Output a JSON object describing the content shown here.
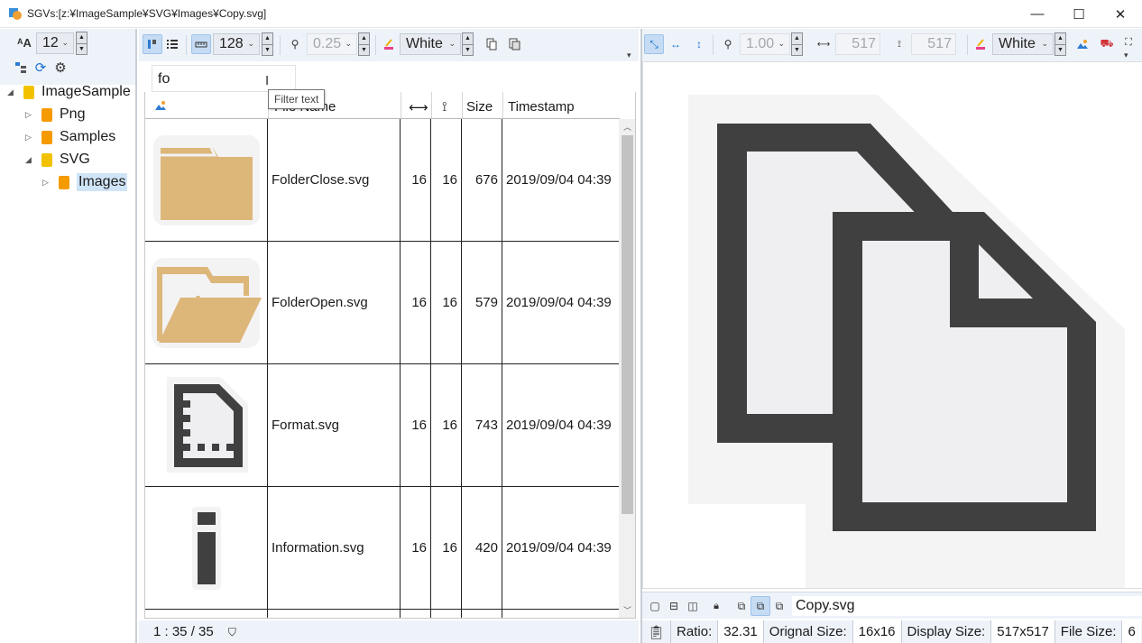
{
  "window": {
    "title": "SGVs:[z:¥ImageSample¥SVG¥Images¥Copy.svg]",
    "controls": {
      "minimize": "—",
      "maximize": "☐",
      "close": "✕"
    }
  },
  "left": {
    "font_size": "12",
    "tree": [
      {
        "label": "ImageSample",
        "expanded": true,
        "level": 0
      },
      {
        "label": "Png",
        "expanded": false,
        "level": 1
      },
      {
        "label": "Samples",
        "expanded": false,
        "level": 1
      },
      {
        "label": "SVG",
        "expanded": true,
        "level": 1
      },
      {
        "label": "Images",
        "expanded": false,
        "level": 2,
        "selected": true
      }
    ]
  },
  "middle": {
    "thumb_size": "128",
    "zoom": "0.25",
    "background": "White",
    "filter_value": "fo",
    "filter_tooltip": "Filter text",
    "columns": {
      "icon": "",
      "name": "File Name",
      "width": "",
      "height": "",
      "size": "Size",
      "timestamp": "Timestamp"
    },
    "rows": [
      {
        "name": "FolderClose.svg",
        "w": "16",
        "h": "16",
        "size": "676",
        "timestamp": "2019/09/04 04:39",
        "icon": "folder-close"
      },
      {
        "name": "FolderOpen.svg",
        "w": "16",
        "h": "16",
        "size": "579",
        "timestamp": "2019/09/04 04:39",
        "icon": "folder-open"
      },
      {
        "name": "Format.svg",
        "w": "16",
        "h": "16",
        "size": "743",
        "timestamp": "2019/09/04 04:39",
        "icon": "format"
      },
      {
        "name": "Information.svg",
        "w": "16",
        "h": "16",
        "size": "420",
        "timestamp": "2019/09/04 04:39",
        "icon": "information"
      }
    ],
    "status": "1 : 35 / 35"
  },
  "right": {
    "zoom": "1.00",
    "width": "517",
    "height": "517",
    "background": "White",
    "file_name": "Copy.svg",
    "status": {
      "ratio_label": "Ratio:",
      "ratio_value": "32.31",
      "original_label": "Orignal Size:",
      "original_value": "16x16",
      "display_label": "Display Size:",
      "display_value": "517x517",
      "filesize_label": "File Size:",
      "filesize_value": "6"
    }
  },
  "colors": {
    "toolbar_bg": "#eef3fa",
    "folder": "#ddb67a",
    "icon_dark": "#404040",
    "icon_light": "#efeff2",
    "selection": "#cfe4f7"
  }
}
